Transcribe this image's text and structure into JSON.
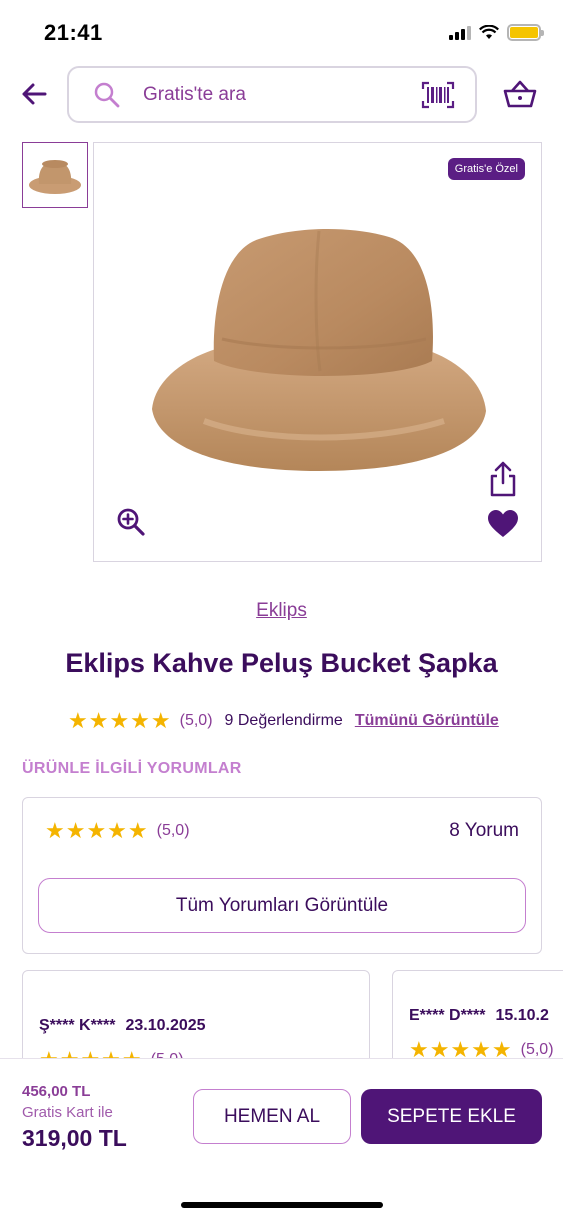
{
  "status_bar": {
    "time": "21:41"
  },
  "header": {
    "search_placeholder": "Gratis'te ara"
  },
  "product": {
    "badge": "Gratis'e Özel",
    "brand": "Eklips",
    "title": "Eklips Kahve Peluş Bucket Şapka",
    "rating_stars": "★★★★★",
    "rating_value": "(5,0)",
    "rating_count": "9 Değerlendirme",
    "view_all": "Tümünü Görüntüle"
  },
  "reviews": {
    "section_title": "ÜRÜNLE İLGİLİ YORUMLAR",
    "summary": {
      "stars": "★★★★★",
      "value": "(5,0)",
      "count": "8 Yorum",
      "button_label": "Tüm Yorumları Görüntüle"
    },
    "items": [
      {
        "author": "Ş**** K****",
        "date": "23.10.2025",
        "stars": "★★★★★",
        "value": "(5,0)"
      },
      {
        "author": "E**** D****",
        "date": "15.10.2",
        "stars": "★★★★★",
        "value": "(5,0)"
      }
    ]
  },
  "purchase": {
    "old_price": "456,00 TL",
    "card_label": "Gratis Kart ile",
    "card_price": "319,00 TL",
    "buy_now": "HEMEN AL",
    "add_to_cart": "SEPETE EKLE"
  },
  "colors": {
    "brand_purple": "#4f1577",
    "accent_purple": "#8a3d97",
    "star": "#f4b400"
  }
}
